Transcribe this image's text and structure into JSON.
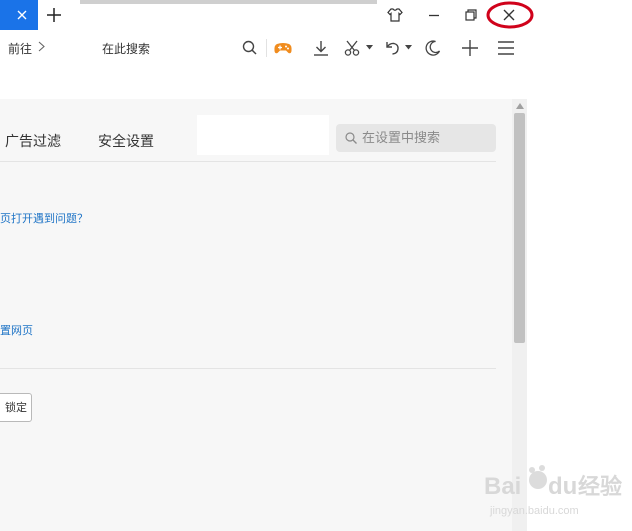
{
  "tabs": {
    "new_tab_icon": "plus-icon",
    "active_tab_close_icon": "close-icon",
    "active_tab_color": "#1a73e8"
  },
  "window_controls": {
    "skin_icon": "shirt-icon",
    "minimize_icon": "minimize-icon",
    "restore_icon": "restore-icon",
    "close_icon": "close-icon",
    "close_highlight_color": "#d0021b"
  },
  "toolbar": {
    "breadcrumb": "前往",
    "search_text": "在此搜索",
    "icons": [
      "search-icon",
      "game-controller-icon",
      "download-icon",
      "scissors-icon",
      "undo-icon",
      "night-mode-icon",
      "plus-icon",
      "menu-icon"
    ],
    "game_icon_color": "#f08c1e"
  },
  "settings": {
    "tabs": [
      {
        "label": "广告过滤"
      },
      {
        "label": "安全设置"
      }
    ],
    "search_placeholder": "在设置中搜索",
    "links": {
      "open_issue": "页打开遇到问题？",
      "webpage": "置网页"
    },
    "lock_button": "锁定"
  },
  "watermark": {
    "brand": "Baidu",
    "site": "经验",
    "url": "jingyan.baidu.com"
  }
}
